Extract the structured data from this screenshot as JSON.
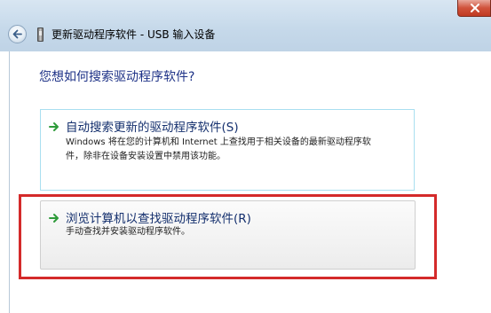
{
  "window": {
    "title": "更新驱动程序软件 - USB 输入设备"
  },
  "main": {
    "heading": "您想如何搜索驱动程序软件?",
    "options": [
      {
        "title": "自动搜索更新的驱动程序软件(S)",
        "desc_line1": "Windows 将在您的计算机和 Internet 上查找用于相关设备的最新驱动程序软",
        "desc_line2": "件，除非在设备安装设置中禁用该功能。"
      },
      {
        "title": "浏览计算机以查找驱动程序软件(R)",
        "desc_line1": "手动查找并安装驱动程序软件。"
      }
    ]
  },
  "icons": {
    "back": "back-arrow-icon",
    "device": "usb-device-icon",
    "option_arrow": "green-arrow-icon",
    "close": "close-icon"
  },
  "colors": {
    "heading": "#1e3287",
    "option_title": "#15306e",
    "arrow": "#2e9b3a",
    "highlight": "#d42a2a",
    "option1_border": "#a9dff0"
  }
}
